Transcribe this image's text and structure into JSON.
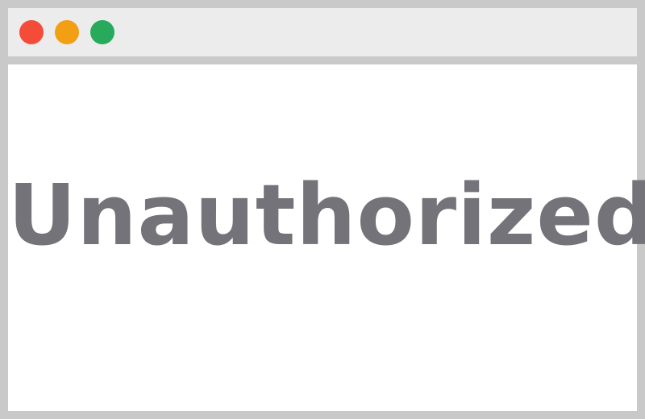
{
  "window": {
    "controls": [
      {
        "name": "close-button",
        "color": "#f44c38"
      },
      {
        "name": "minimize-button",
        "color": "#f29f14"
      },
      {
        "name": "maximize-button",
        "color": "#28aa5d"
      }
    ]
  },
  "content": {
    "message": "Unauthorized",
    "message_color": "#747379"
  }
}
